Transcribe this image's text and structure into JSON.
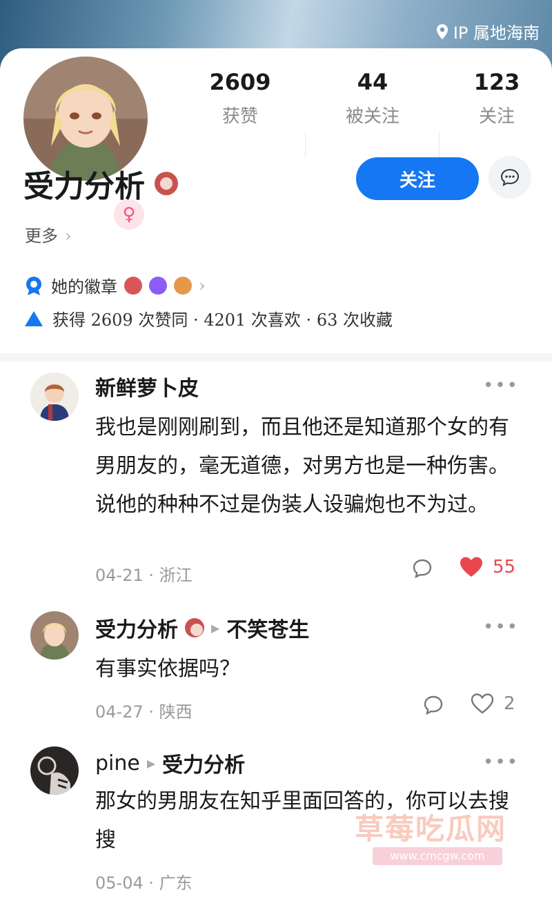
{
  "header": {
    "ip_label": "IP 属地海南"
  },
  "profile": {
    "name": "受力分析",
    "gender": "♀",
    "stats": [
      {
        "num": "2609",
        "label": "获赞"
      },
      {
        "num": "44",
        "label": "被关注"
      },
      {
        "num": "123",
        "label": "关注"
      }
    ],
    "follow_label": "关注",
    "more_label": "更多",
    "badges_label": "她的徽章",
    "agree_line": "获得 2609 次赞同 · 4201 次喜欢 · 63 次收藏"
  },
  "comments": [
    {
      "author": "新鲜萝卜皮",
      "reply_to": "",
      "text": "我也是刚刚刷到，而且他还是知道那个女的有男朋友的，毫无道德，对男方也是一种伤害。说他的种种不过是伪装人设骗炮也不为过。",
      "date": "04-21",
      "location": "浙江",
      "likes": "55"
    },
    {
      "author": "受力分析",
      "reply_to": "不笑苍生",
      "text": "有事实依据吗？",
      "date": "04-27",
      "location": "陕西",
      "likes": "2"
    },
    {
      "author": "pine",
      "reply_to": "受力分析",
      "text": "那女的男朋友在知乎里面回答的，你可以去搜搜",
      "date": "05-04",
      "location": "广东",
      "likes": ""
    }
  ],
  "watermark": {
    "text": "草莓吃瓜网",
    "url": "www.cmcgw.com"
  },
  "colors": {
    "accent": "#1677f2",
    "like": "#e8474d",
    "gender": "#f0577e"
  }
}
